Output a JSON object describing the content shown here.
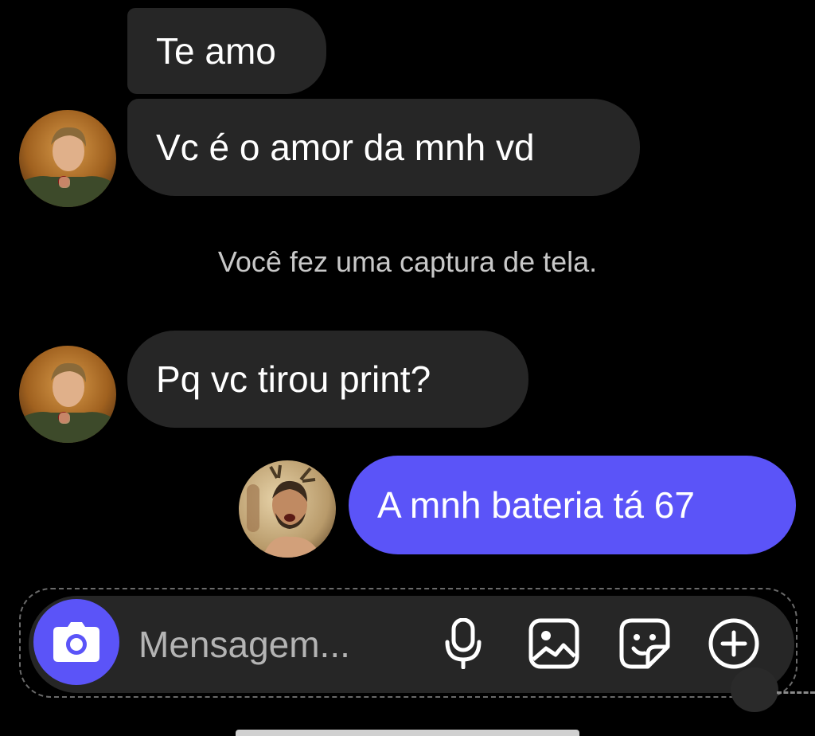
{
  "messages": [
    {
      "id": "msg-1",
      "text": "Te amo",
      "from": "other"
    },
    {
      "id": "msg-2",
      "text": "Vc é o amor da mnh vd",
      "from": "other"
    },
    {
      "id": "msg-3",
      "text": "Pq vc tirou print?",
      "from": "other"
    },
    {
      "id": "msg-4",
      "text": "A mnh bateria tá 67",
      "from": "me"
    }
  ],
  "notice": "Você fez uma captura de tela.",
  "composer": {
    "placeholder": "Mensagem...",
    "icons": [
      "camera-icon",
      "microphone-icon",
      "image-gallery-icon",
      "sticker-icon",
      "plus-circle-icon"
    ]
  },
  "colors": {
    "background": "#000000",
    "bubble_other": "#262626",
    "bubble_me": "#5b54f8",
    "accent": "#5b54f8",
    "notice_text": "#c8c8c8"
  }
}
